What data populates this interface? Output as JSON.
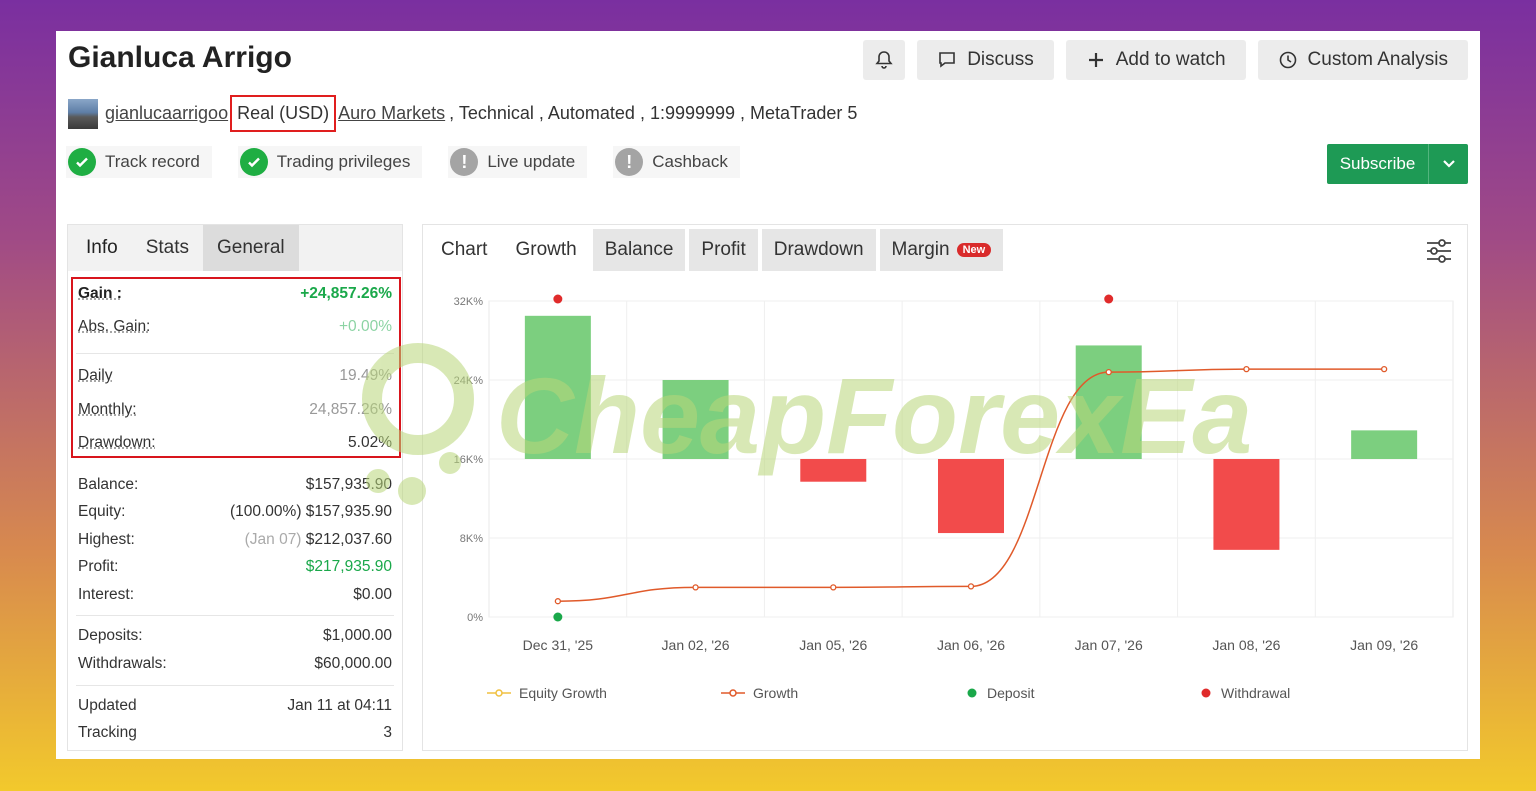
{
  "header": {
    "title": "Gianluca Arrigo",
    "buttons": {
      "discuss": "Discuss",
      "add_to_watch": "Add to watch",
      "custom_analysis": "Custom Analysis"
    }
  },
  "meta": {
    "username": "gianlucaarrigoo",
    "account": "Real (USD)",
    "broker": "Auro Markets",
    "details": ", Technical , Automated , 1:9999999 , MetaTrader 5"
  },
  "badges": [
    {
      "label": "Track record",
      "status": "ok"
    },
    {
      "label": "Trading privileges",
      "status": "ok"
    },
    {
      "label": "Live update",
      "status": "warn"
    },
    {
      "label": "Cashback",
      "status": "warn"
    }
  ],
  "subscribe": "Subscribe",
  "left_tabs": [
    "Info",
    "Stats",
    "General"
  ],
  "stats": {
    "gain": {
      "k": "Gain :",
      "v": "+24,857.26%"
    },
    "abs_gain": {
      "k": "Abs. Gain:",
      "v": "+0.00%"
    },
    "daily": {
      "k": "Daily",
      "v": "19.49%"
    },
    "monthly": {
      "k": "Monthly:",
      "v": "24,857.26%"
    },
    "drawdown": {
      "k": "Drawdown:",
      "v": "5.02%"
    },
    "balance": {
      "k": "Balance:",
      "v": "$157,935.90"
    },
    "equity": {
      "k": "Equity:",
      "v_pct": "(100.00%)",
      "v": "$157,935.90"
    },
    "highest": {
      "k": "Highest:",
      "v_date": "(Jan 07)",
      "v": "$212,037.60"
    },
    "profit": {
      "k": "Profit:",
      "v": "$217,935.90"
    },
    "interest": {
      "k": "Interest:",
      "v": "$0.00"
    },
    "deposits": {
      "k": "Deposits:",
      "v": "$1,000.00"
    },
    "withdrawals": {
      "k": "Withdrawals:",
      "v": "$60,000.00"
    },
    "updated": {
      "k": "Updated",
      "v": "Jan 11 at 04:11"
    },
    "tracking": {
      "k": "Tracking",
      "v": "3"
    }
  },
  "right_tabs": [
    "Chart",
    "Growth",
    "Balance",
    "Profit",
    "Drawdown",
    "Margin"
  ],
  "new_tag": "New",
  "watermark": "CheapForexEa",
  "colors": {
    "green": "#1e9a55",
    "bar_green": "#7ccf7f",
    "bar_red": "#f24b4b",
    "line": "#e05a2a",
    "accent_red": "#d8151d"
  },
  "chart_data": {
    "type": "bar",
    "categories": [
      "Dec 31, '25",
      "Jan 02, '26",
      "Jan 05, '26",
      "Jan 06, '26",
      "Jan 07, '26",
      "Jan 08, '26",
      "Jan 09, '26"
    ],
    "y_ticks": [
      "0%",
      "8K%",
      "16K%",
      "24K%",
      "32K%"
    ],
    "ylim": [
      0,
      32000
    ],
    "baseline": 16000,
    "bars": [
      14500,
      8000,
      -2300,
      -7500,
      11500,
      -9200,
      2900
    ],
    "growth_line": [
      1600,
      3000,
      3000,
      3100,
      24800,
      25100,
      25100
    ],
    "withdrawal_markers": [
      0,
      4
    ],
    "deposit_markers": [
      0
    ],
    "legend": [
      "Equity Growth",
      "Growth",
      "Deposit",
      "Withdrawal"
    ]
  }
}
